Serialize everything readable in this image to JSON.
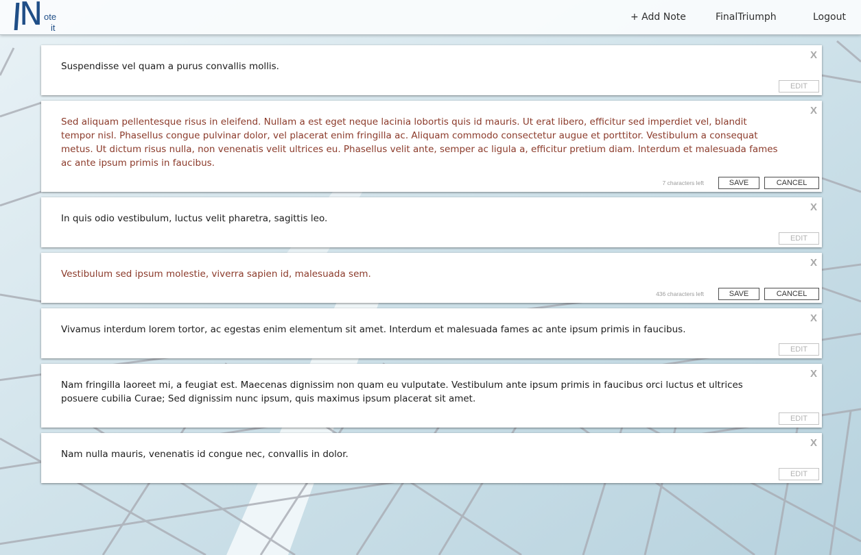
{
  "header": {
    "logo": {
      "letter": "N",
      "line1": "ote",
      "line2": "it"
    },
    "nav": {
      "add_note": "+ Add Note",
      "username": "FinalTriumph",
      "logout": "Logout"
    }
  },
  "notes": [
    {
      "text": "Suspendisse vel quam a purus convallis mollis.",
      "editing": false,
      "close_label": "X",
      "edit_label": "EDIT"
    },
    {
      "text": "Sed aliquam pellentesque risus in eleifend. Nullam a est eget neque lacinia lobortis quis id mauris. Ut erat libero, efficitur sed imperdiet vel, blandit tempor nisl. Phasellus congue pulvinar dolor, vel placerat enim fringilla ac. Aliquam commodo consectetur augue et porttitor. Vestibulum a consequat metus. Ut dictum risus nulla, non venenatis velit ultrices eu. Phasellus velit ante, semper ac ligula a, efficitur pretium diam. Interdum et malesuada fames ac ante ipsum primis in faucibus.",
      "editing": true,
      "close_label": "X",
      "chars_left": "7 characters left",
      "save_label": "SAVE",
      "cancel_label": "CANCEL"
    },
    {
      "text": "In quis odio vestibulum, luctus velit pharetra, sagittis leo.",
      "editing": false,
      "close_label": "X",
      "edit_label": "EDIT"
    },
    {
      "text": "Vestibulum sed ipsum molestie, viverra sapien id, malesuada sem.",
      "editing": true,
      "close_label": "X",
      "chars_left": "436 characters left",
      "save_label": "SAVE",
      "cancel_label": "CANCEL"
    },
    {
      "text": "Vivamus interdum lorem tortor, ac egestas enim elementum sit amet. Interdum et malesuada fames ac ante ipsum primis in faucibus.",
      "editing": false,
      "close_label": "X",
      "edit_label": "EDIT"
    },
    {
      "text": "Nam fringilla laoreet mi, a feugiat est. Maecenas dignissim non quam eu vulputate. Vestibulum ante ipsum primis in faucibus orci luctus et ultrices posuere cubilia Curae; Sed dignissim nunc ipsum, quis maximus ipsum placerat sit amet.",
      "editing": false,
      "close_label": "X",
      "edit_label": "EDIT"
    },
    {
      "text": "Nam nulla mauris, venenatis id congue nec, convallis in dolor.",
      "editing": false,
      "close_label": "X",
      "edit_label": "EDIT"
    }
  ],
  "colors": {
    "brand": "#1f4e87",
    "editing_text": "#8b3a2a",
    "background": "#cfe3ec"
  }
}
